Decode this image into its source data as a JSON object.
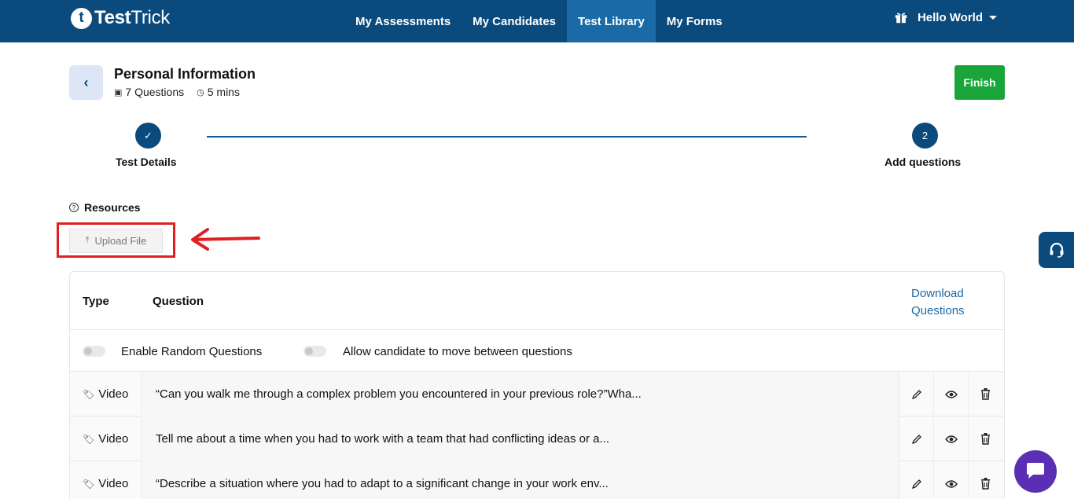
{
  "brand": {
    "mark": "t",
    "name_bold": "Test",
    "name_light": "Trick"
  },
  "nav": {
    "items": [
      {
        "label": "My Assessments"
      },
      {
        "label": "My Candidates"
      },
      {
        "label": "Test Library"
      },
      {
        "label": "My Forms"
      }
    ],
    "active": "Test Library",
    "user_label": "Hello World"
  },
  "header": {
    "back_label": "‹",
    "title": "Personal Information",
    "questions": "7 Questions",
    "duration": "5 mins",
    "finish_label": "Finish"
  },
  "stepper": {
    "steps": [
      {
        "label": "Test Details",
        "state": "done",
        "marker": "✓"
      },
      {
        "label": "Add questions",
        "state": "current",
        "marker": "2"
      }
    ]
  },
  "resources": {
    "title": "Resources",
    "upload_label": "Upload File"
  },
  "table": {
    "col_type": "Type",
    "col_question": "Question",
    "download_line1": "Download",
    "download_line2": "Questions",
    "toggle_random": "Enable Random Questions",
    "toggle_move": "Allow candidate to move between questions",
    "rows": [
      {
        "type": "Video",
        "question": "“Can you walk me through a complex problem you encountered in your previous role?”Wha..."
      },
      {
        "type": "Video",
        "question": "Tell me about a time when you had to work with a team that had conflicting ideas or a..."
      },
      {
        "type": "Video",
        "question": "“Describe a situation where you had to adapt to a significant change in your work env..."
      }
    ]
  },
  "colors": {
    "nav_bg": "#0a4a7c",
    "nav_active": "#1a6aa6",
    "finish": "#1aa53a",
    "highlight": "#e02020",
    "chat": "#5b2fb3"
  }
}
